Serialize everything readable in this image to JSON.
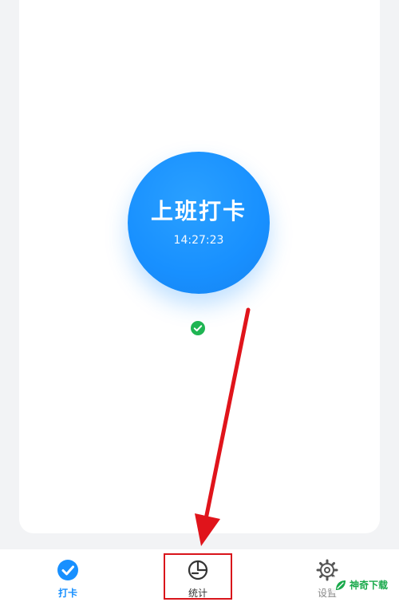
{
  "clock_in": {
    "title": "上班打卡",
    "time": "14:27:23",
    "accent_color": "#1890ff"
  },
  "status": {
    "icon": "check-circle-icon",
    "color": "#1fb553"
  },
  "tabbar": {
    "tabs": [
      {
        "label": "打卡",
        "icon": "check-circle-icon",
        "active": true
      },
      {
        "label": "统计",
        "icon": "pie-chart-icon",
        "active": false,
        "highlighted": true
      },
      {
        "label": "设置",
        "icon": "gear-icon",
        "active": false
      }
    ]
  },
  "annotation": {
    "arrow_color": "#d9141b",
    "box_color": "#d9141b"
  },
  "watermark": {
    "text": "神奇下载",
    "color": "#19a94b"
  }
}
